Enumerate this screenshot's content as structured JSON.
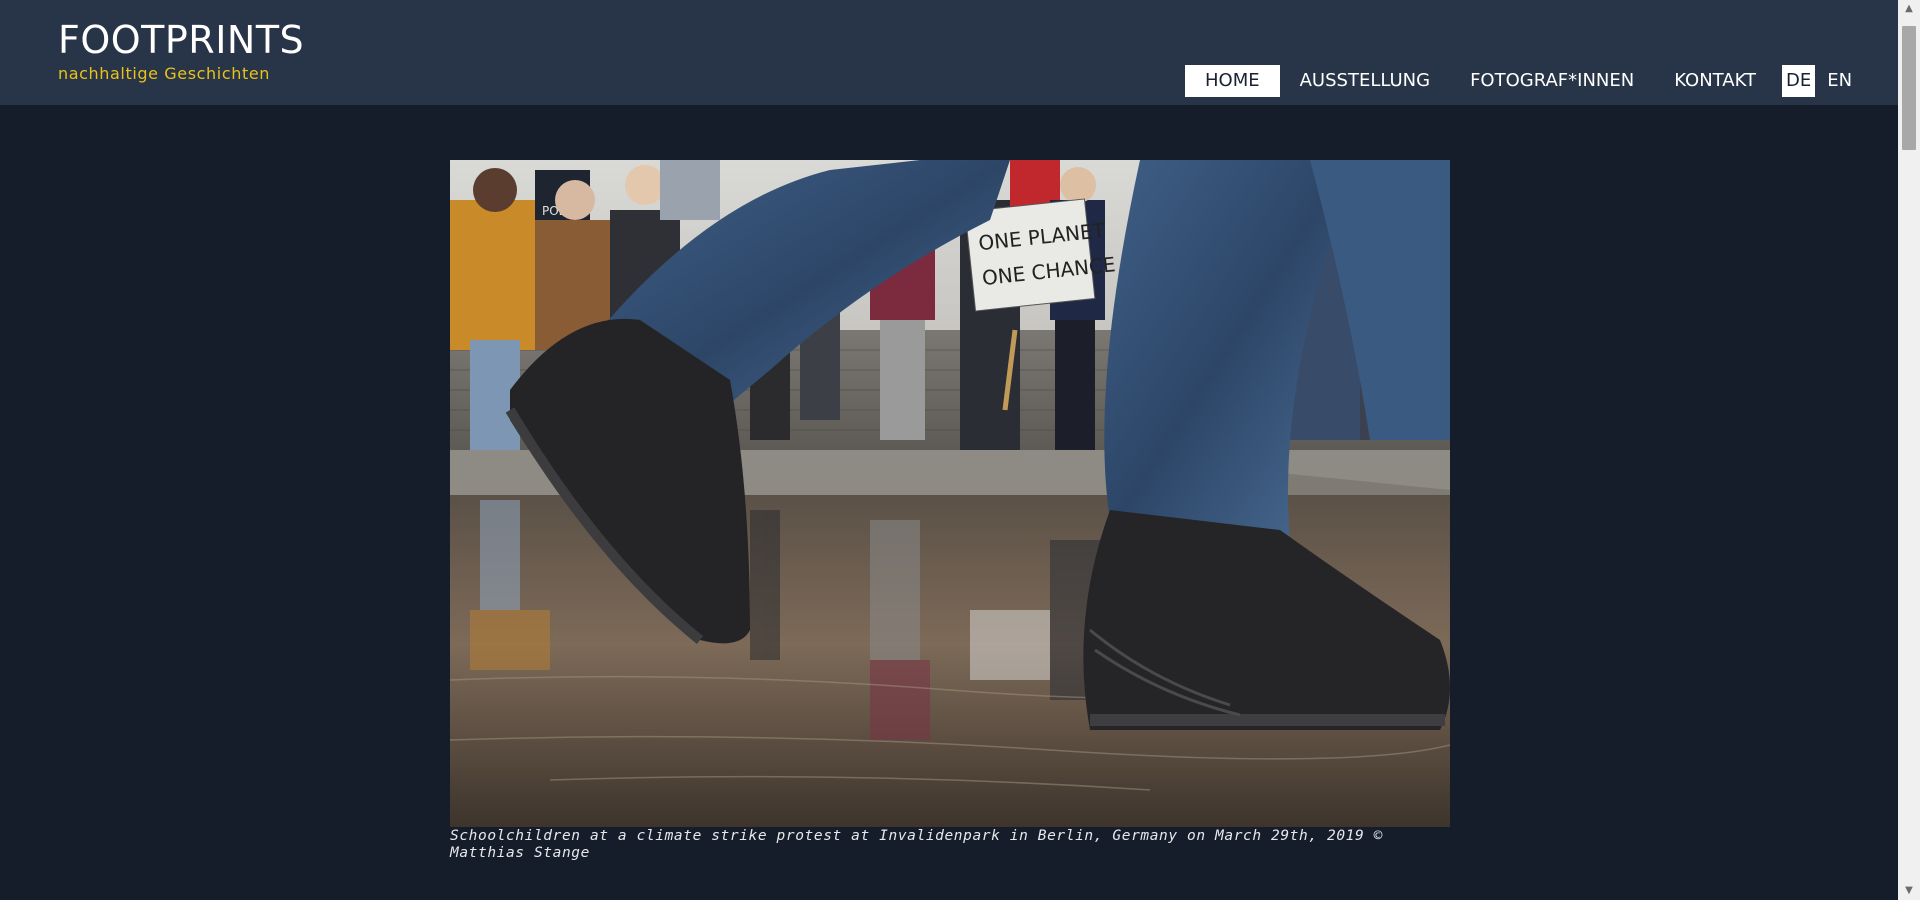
{
  "site": {
    "title": "FOOTPRINTS",
    "subtitle": "nachhaltige Geschichten"
  },
  "nav": {
    "items": [
      {
        "label": "HOME",
        "active": true
      },
      {
        "label": "AUSSTELLUNG",
        "active": false
      },
      {
        "label": "FOTOGRAF*INNEN",
        "active": false
      },
      {
        "label": "KONTAKT",
        "active": false
      }
    ],
    "languages": [
      {
        "label": "DE",
        "active": true
      },
      {
        "label": "EN",
        "active": false
      }
    ]
  },
  "photo": {
    "sign_text_line1": "ONE PLANET",
    "sign_text_line2": "ONE CHANCE",
    "sign_text_police": "POLIZEI"
  },
  "caption": "Schoolchildren at a climate strike protest at Invalidenpark in Berlin, Germany on March 29th, 2019 © Matthias Stange",
  "colors": {
    "background": "#151d2b",
    "header": "#283447",
    "accent": "#e8c31b"
  },
  "icons": {
    "scroll_up": "chevron-up-icon",
    "scroll_down": "chevron-down-icon"
  }
}
